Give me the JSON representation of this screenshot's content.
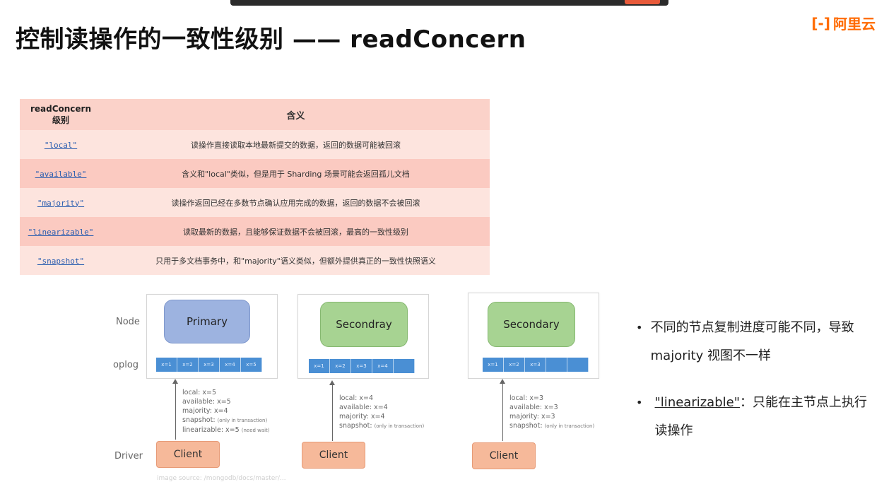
{
  "title": "控制读操作的一致性级别 —— readConcern",
  "logo": {
    "mark": "[-]",
    "text": "阿里云"
  },
  "table": {
    "header": {
      "col1": "readConcern\n级别",
      "col2": "含义"
    },
    "rows": [
      {
        "level": "\"local\"",
        "desc": "读操作直接读取本地最新提交的数据，返回的数据可能被回滚"
      },
      {
        "level": "\"available\"",
        "desc": "含义和\"local\"类似，但是用于 Sharding 场景可能会返回孤儿文档"
      },
      {
        "level": "\"majority\"",
        "desc": "读操作返回已经在多数节点确认应用完成的数据，返回的数据不会被回滚"
      },
      {
        "level": "\"linearizable\"",
        "desc": "读取最新的数据，且能够保证数据不会被回滚，最高的一致性级别"
      },
      {
        "level": "\"snapshot\"",
        "desc": "只用于多文档事务中，和\"majority\"语义类似，但额外提供真正的一致性快照语义"
      }
    ]
  },
  "diagram": {
    "labels": {
      "node": "Node",
      "oplog": "oplog",
      "driver": "Driver"
    },
    "nodes": [
      {
        "name": "Primary",
        "oplog": [
          "x=1",
          "x=2",
          "x=3",
          "x=4",
          "x=5"
        ],
        "reads": [
          "local: x=5",
          "available: x=5",
          "majority: x=4"
        ],
        "snapshot": "snapshot:",
        "snapshot_note": "(only in transaction)",
        "linearizable": "linearizable: x=5",
        "linearizable_note": "(need wait)",
        "client": "Client"
      },
      {
        "name": "Secondray",
        "oplog": [
          "x=1",
          "x=2",
          "x=3",
          "x=4",
          ""
        ],
        "reads": [
          "local: x=4",
          "available: x=4",
          "majority: x=4"
        ],
        "snapshot": "snapshot:",
        "snapshot_note": "(only in transaction)",
        "client": "Client"
      },
      {
        "name": "Secondary",
        "oplog": [
          "x=1",
          "x=2",
          "x=3",
          "",
          ""
        ],
        "reads": [
          "local: x=3",
          "available: x=3",
          "majority: x=3"
        ],
        "snapshot": "snapshot:",
        "snapshot_note": "(only in transaction)",
        "client": "Client"
      }
    ],
    "caption": "image source: /mongodb/docs/master/..."
  },
  "bullets": {
    "item1": "不同的节点复制进度可能不同，导致 majority 视图不一样",
    "item2_code": "\"linearizable\"",
    "item2_rest": "：只能在主节点上执行读操作"
  },
  "colors": {
    "table_header": "#fbd2c9",
    "table_row_light": "#fde4de",
    "table_row_dark": "#fbcac1",
    "primary_node": "#9db3e0",
    "secondary_node": "#a7d392",
    "oplog": "#4a8fd4",
    "client": "#f6b99a",
    "logo": "#ff6a00"
  }
}
